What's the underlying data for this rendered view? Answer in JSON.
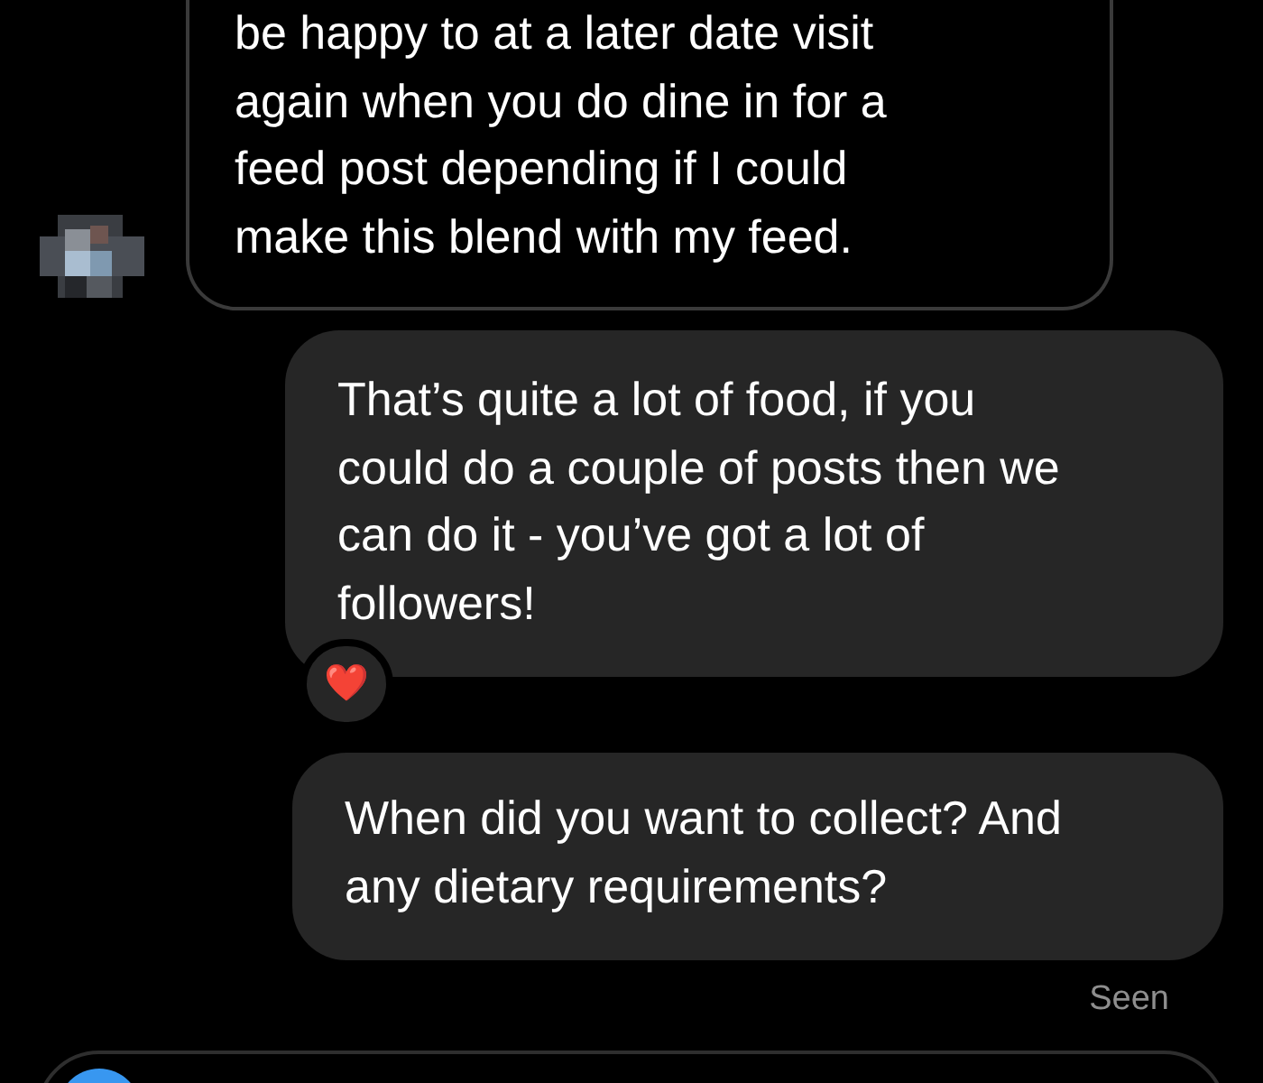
{
  "messages": [
    {
      "kind": "received",
      "lines": [
        "be happy to at a later date visit",
        "again when you do dine in for a",
        "feed post depending if I could",
        "make this blend with my feed."
      ]
    },
    {
      "kind": "sent",
      "lines": [
        "That’s quite a lot of food, if you",
        "could do a couple of posts then we",
        "can do it - you’ve got a lot of",
        "followers!"
      ],
      "reaction": "❤️"
    },
    {
      "kind": "sent",
      "lines": [
        "When did you want to collect? And",
        "any dietary requirements?"
      ]
    }
  ],
  "status": "Seen"
}
